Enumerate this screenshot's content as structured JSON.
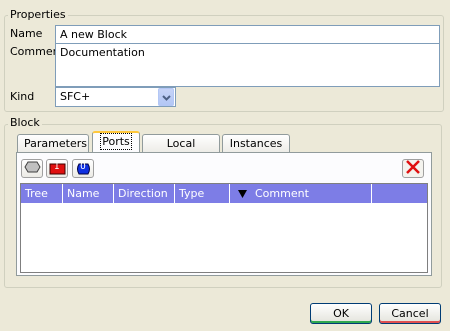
{
  "properties": {
    "title": "Properties",
    "name_label": "Name",
    "name_value": "A new Block",
    "comment_label": "Comment",
    "comment_value": "Documentation",
    "kind_label": "Kind",
    "kind_value": "SFC+"
  },
  "block": {
    "title": "Block",
    "tabs": [
      {
        "label": "Parameters"
      },
      {
        "label": "Ports"
      },
      {
        "label": "Local Signals"
      },
      {
        "label": "Instances"
      }
    ],
    "active_tab": "Ports",
    "toolbar": {
      "input_label": "I",
      "output_label": "O"
    },
    "columns": [
      "Tree",
      "Name",
      "Direction",
      "Type",
      "Comment"
    ]
  },
  "footer": {
    "ok_label": "OK",
    "cancel_label": "Cancel"
  },
  "colors": {
    "header_bg": "#7d7de6",
    "delete_red": "#e01010",
    "ok_accent": "#2fa84f",
    "cancel_accent": "#e05050"
  }
}
